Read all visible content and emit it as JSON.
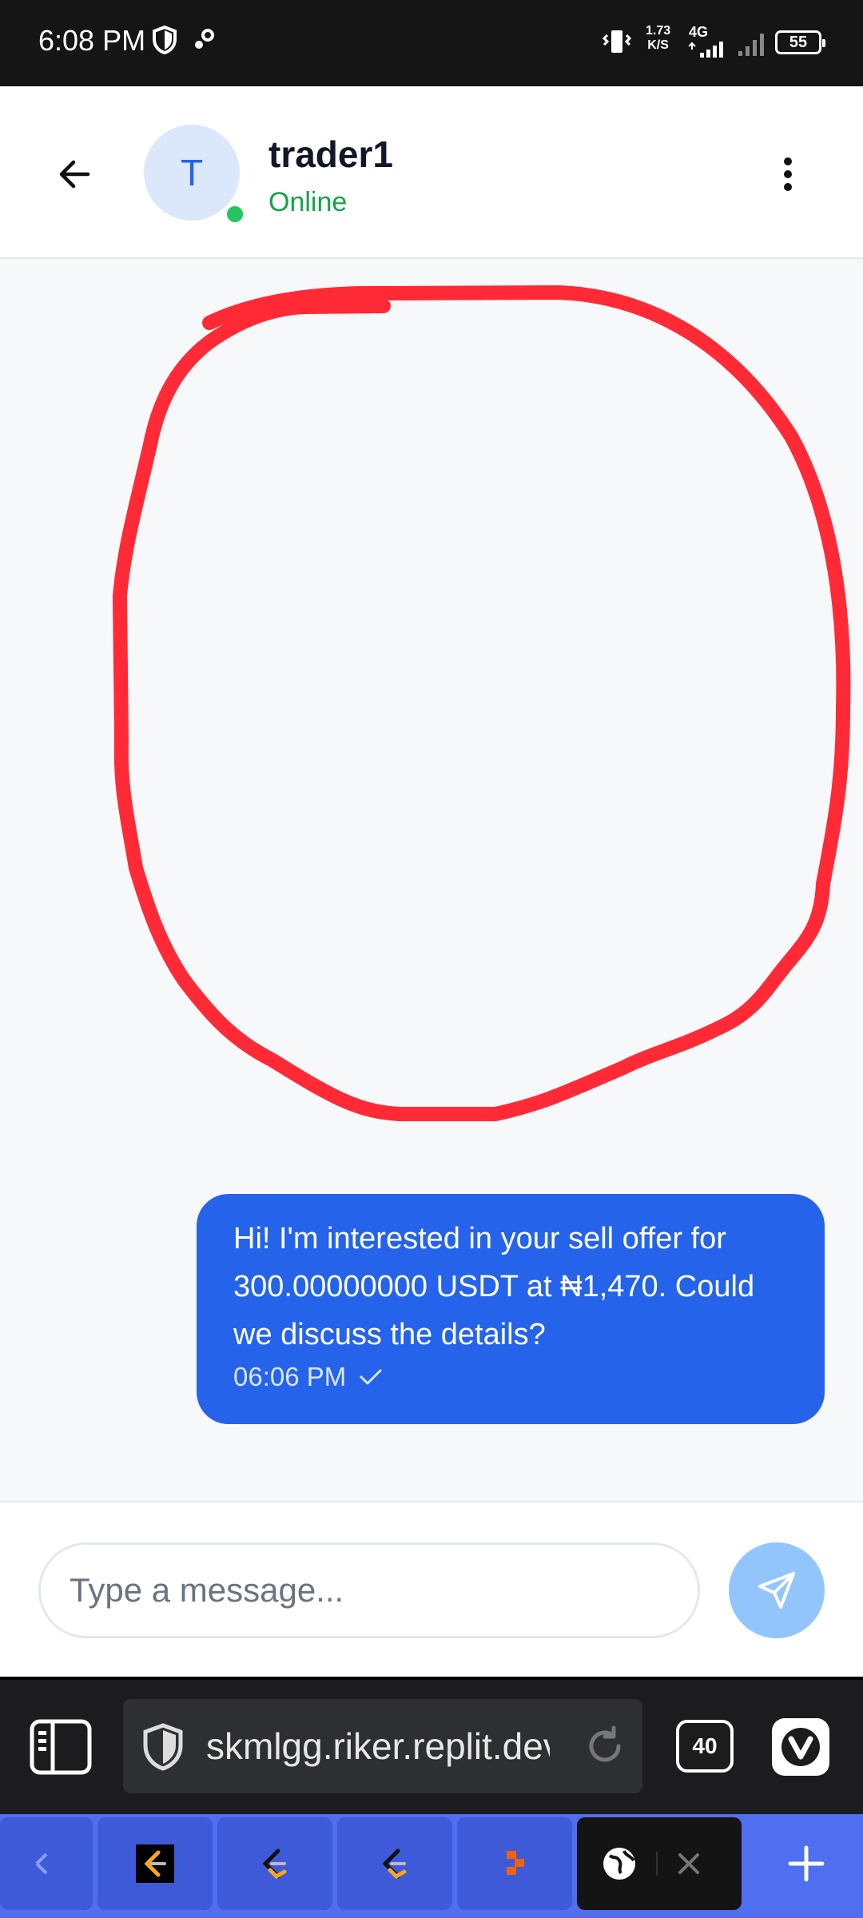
{
  "status_bar": {
    "time": "6:08 PM",
    "net_speed_value": "1.73",
    "net_speed_unit": "K/S",
    "network_type": "4G",
    "battery": "55"
  },
  "chat_header": {
    "avatar_initial": "T",
    "contact_name": "trader1",
    "contact_status": "Online"
  },
  "messages": [
    {
      "text": "Hi! I'm interested in your sell offer for 300.00000000 USDT at ₦1,470. Could we discuss the details?",
      "time": "06:06 PM",
      "outgoing": true
    }
  ],
  "composer": {
    "placeholder": "Type a message..."
  },
  "browser": {
    "url": "skmlgg.riker.replit.dev",
    "tab_count": "40"
  },
  "colors": {
    "accent": "#2563eb",
    "online": "#22c55e",
    "send_button": "#93c5fd",
    "annotation": "#ff2a36",
    "tab_strip": "#4f6ef0"
  }
}
